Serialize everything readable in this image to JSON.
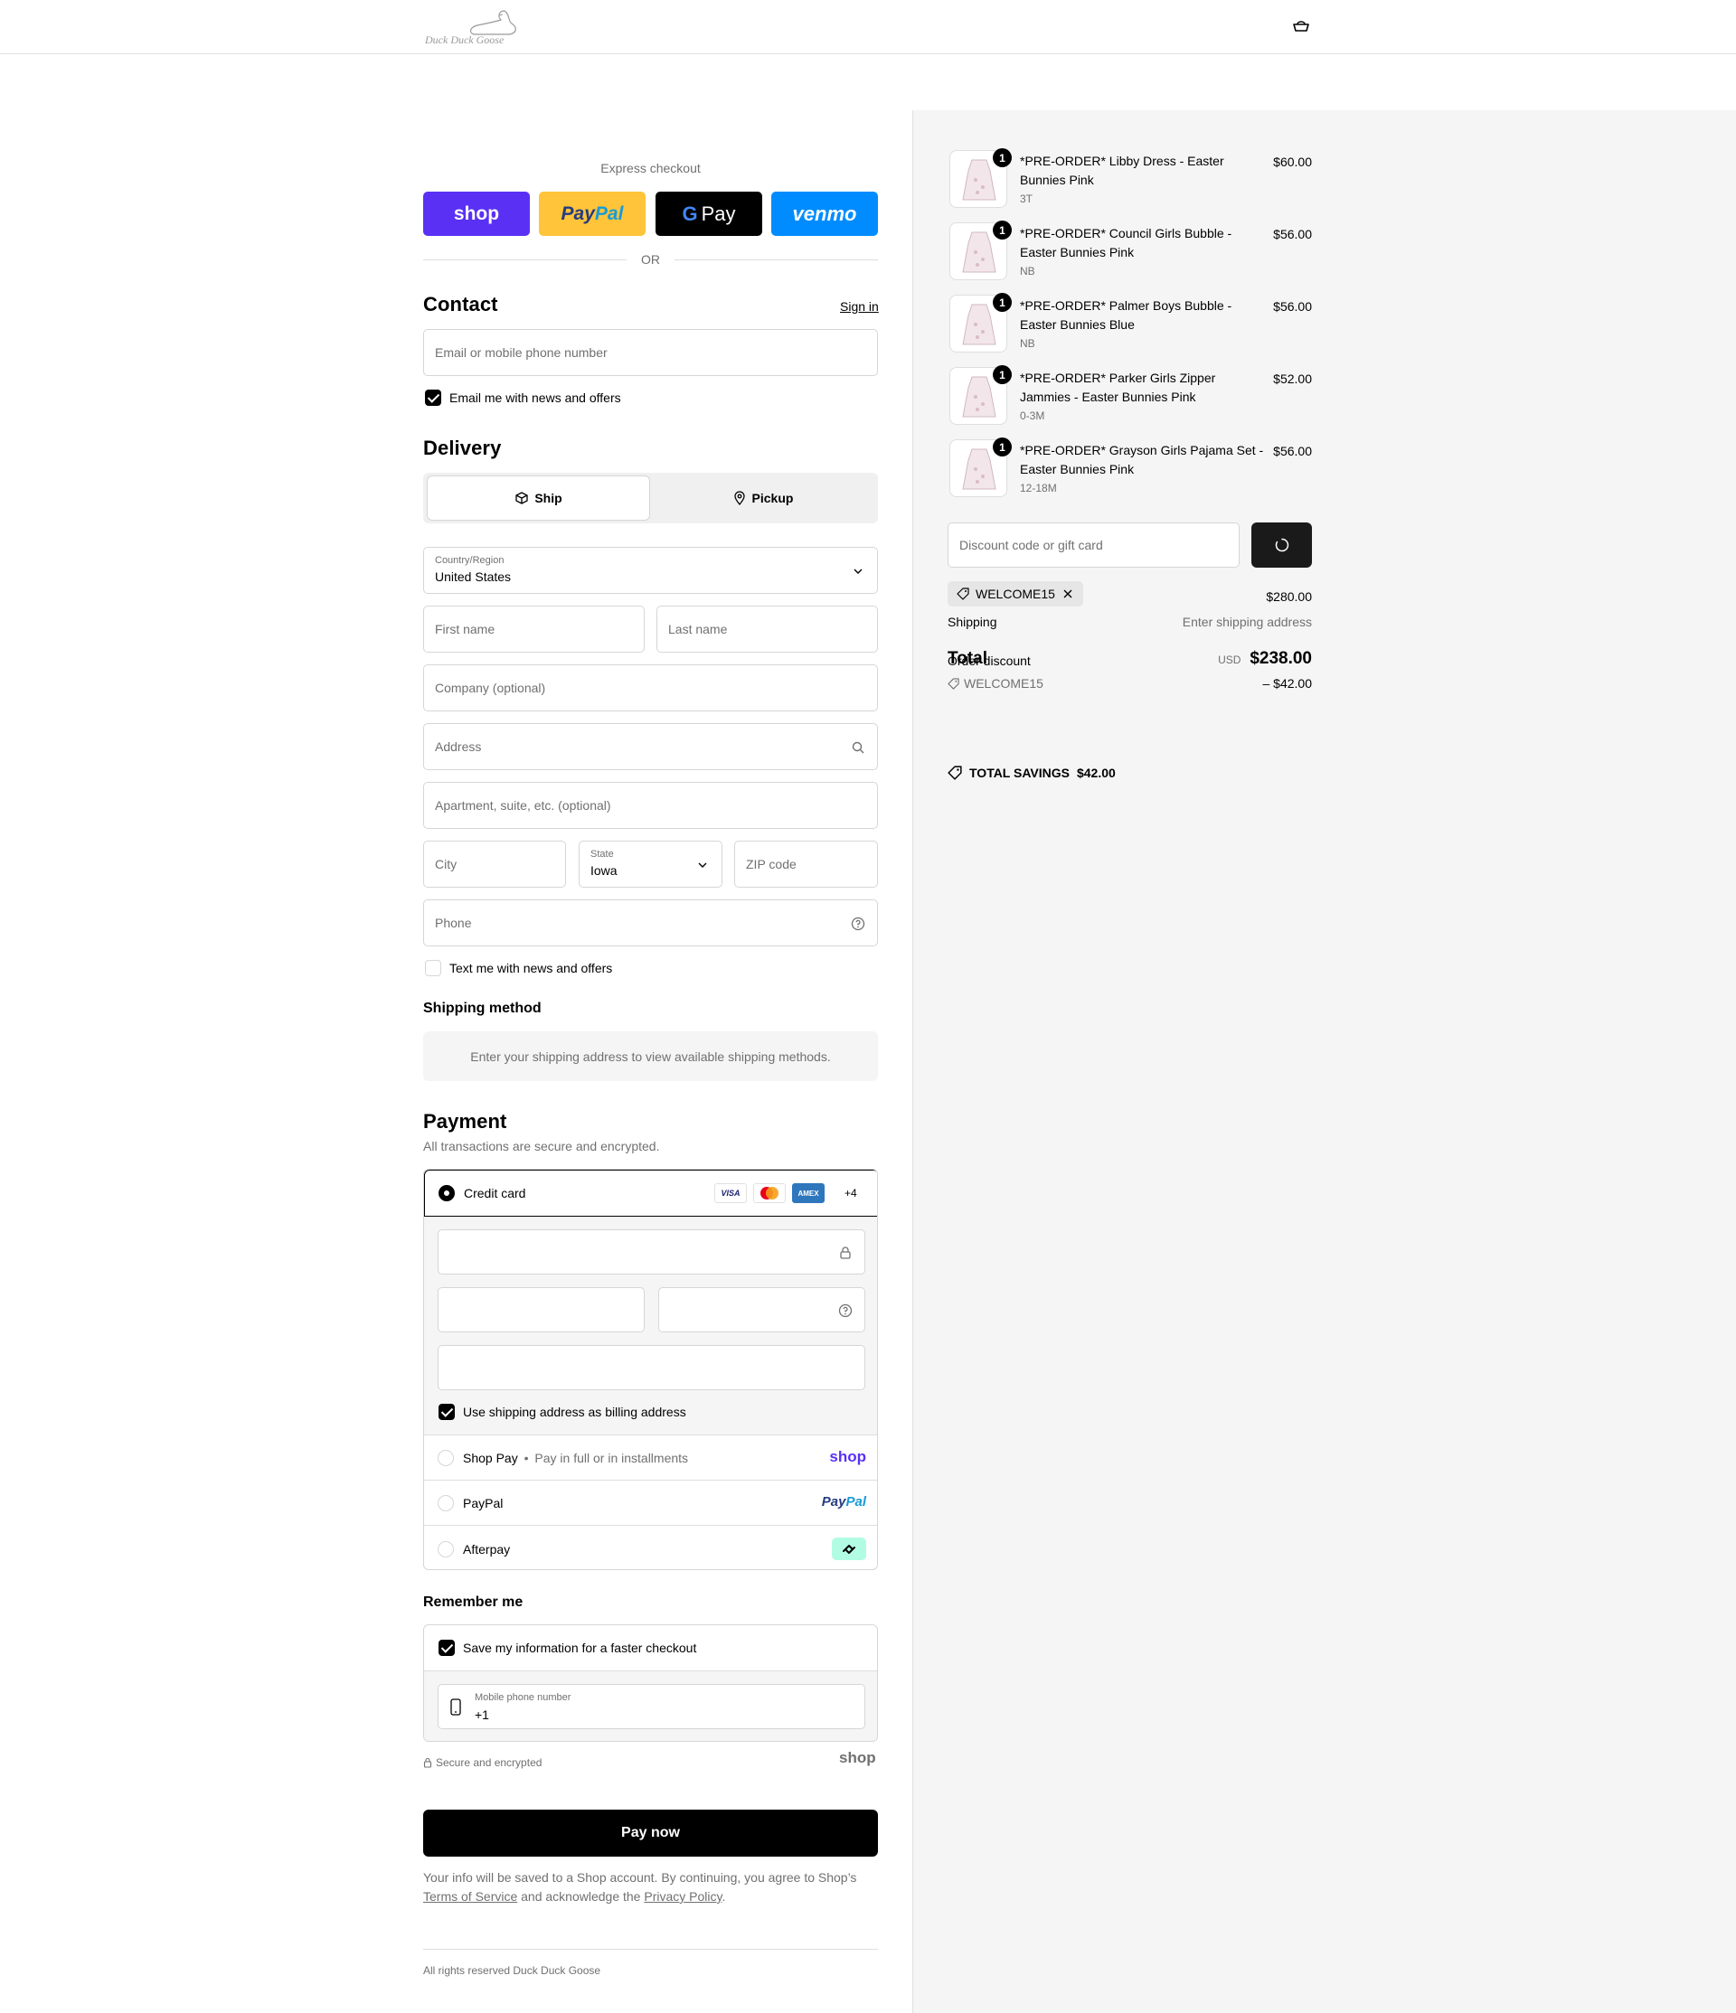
{
  "header": {
    "logo_text": "Duck Duck Goose",
    "cart_icon": "bag-icon"
  },
  "express": {
    "label": "Express checkout",
    "buttons": [
      {
        "label": "shop",
        "color": "#5a31f4"
      },
      {
        "label": "PayPal",
        "color": "#ffc439"
      },
      {
        "label": "Pay",
        "color": "#000000"
      },
      {
        "label": "venmo",
        "color": "#008cff"
      }
    ],
    "or": "OR"
  },
  "contact": {
    "title": "Contact",
    "sign_in": "Sign in",
    "email_placeholder": "Email or mobile phone number",
    "email_news_label": "Email me with news and offers",
    "email_news_checked": true
  },
  "delivery": {
    "title": "Delivery",
    "tabs": [
      {
        "label": "Ship",
        "icon": "box-icon",
        "selected": true
      },
      {
        "label": "Pickup",
        "icon": "location-pin-icon",
        "selected": false
      }
    ],
    "country_label": "Country/Region",
    "country_value": "United States",
    "first_name": "First name",
    "last_name": "Last name",
    "company": "Company (optional)",
    "address": "Address",
    "apartment": "Apartment, suite, etc. (optional)",
    "city": "City",
    "state_label": "State",
    "state_value": "Iowa",
    "zip": "ZIP code",
    "phone": "Phone",
    "text_news_label": "Text me with news and offers",
    "text_news_checked": false
  },
  "shipping_method": {
    "title": "Shipping method",
    "notice": "Enter your shipping address to view available shipping methods."
  },
  "payment": {
    "title": "Payment",
    "subtitle": "All transactions are secure and encrypted.",
    "credit_card_label": "Credit card",
    "card_brands": [
      "VISA",
      "mastercard",
      "AMEX"
    ],
    "more_brands": "+4",
    "billing_label": "Use shipping address as billing address",
    "billing_checked": true,
    "shop_pay_label": "Shop Pay",
    "shop_pay_sub": "Pay in full or in installments",
    "shop_pay_logo": "shop",
    "paypal_label": "PayPal",
    "paypal_logo": "PayPal",
    "afterpay_label": "Afterpay"
  },
  "remember": {
    "title": "Remember me",
    "save_label": "Save my information for a faster checkout",
    "save_checked": true,
    "mobile_label": "Mobile phone number",
    "mobile_value": "+1",
    "secure_text": "Secure and encrypted",
    "shop_logo": "shop"
  },
  "pay_button": "Pay now",
  "legal": {
    "prefix": "Your info will be saved to a Shop account. By continuing, you agree to Shop’s",
    "terms": "Terms of Service",
    "middle": "and acknowledge the",
    "privacy": "Privacy Policy",
    "suffix": "."
  },
  "footer": "All rights reserved Duck Duck Goose",
  "summary": {
    "items": [
      {
        "name": "*PRE-ORDER* Libby Dress - Easter Bunnies Pink",
        "variant": "3T",
        "price": "$60.00",
        "qty": "1"
      },
      {
        "name": "*PRE-ORDER* Council Girls Bubble - Easter Bunnies Pink",
        "variant": "NB",
        "price": "$56.00",
        "qty": "1"
      },
      {
        "name": "*PRE-ORDER* Palmer Boys Bubble - Easter Bunnies Blue",
        "variant": "NB",
        "price": "$56.00",
        "qty": "1"
      },
      {
        "name": "*PRE-ORDER* Parker Girls Zipper Jammies - Easter Bunnies Pink",
        "variant": "0-3M",
        "price": "$52.00",
        "qty": "1"
      },
      {
        "name": "*PRE-ORDER* Grayson Girls Pajama Set - Easter Bunnies Pink",
        "variant": "12-18M",
        "price": "$56.00",
        "qty": "1"
      }
    ],
    "discount_placeholder": "Discount code or gift card",
    "applied_code": "WELCOME15",
    "subtotal_value": "$280.00",
    "shipping_label": "Shipping",
    "shipping_value": "Enter shipping address",
    "order_discount_label": "Order discount",
    "total_label": "Total",
    "currency": "USD",
    "total_value": "$238.00",
    "discount_code": "WELCOME15",
    "discount_value": "– $42.00",
    "savings_label": "TOTAL SAVINGS",
    "savings_value": "$42.00"
  }
}
